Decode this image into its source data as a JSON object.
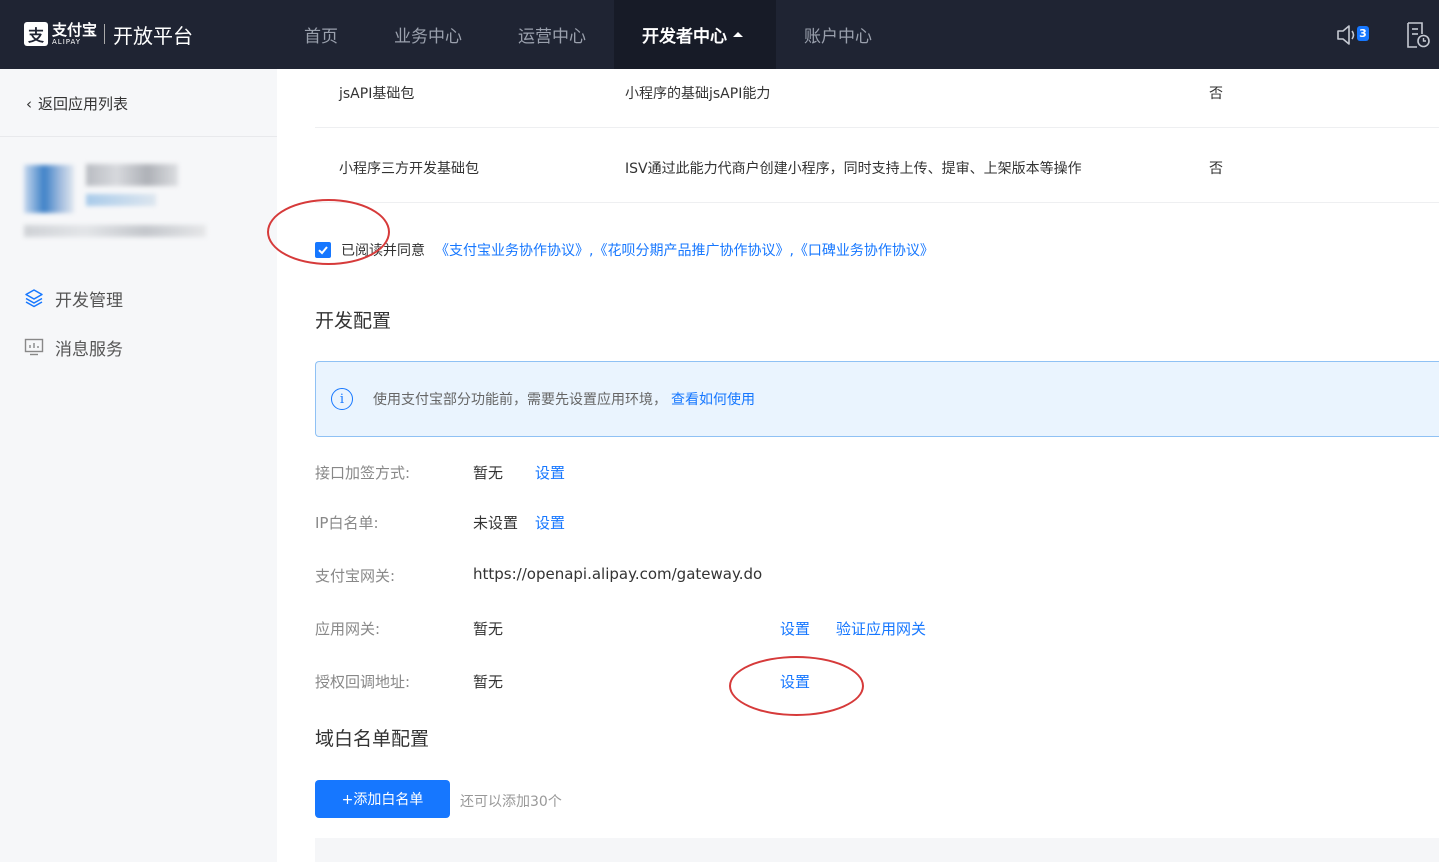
{
  "header": {
    "logo_mark": "支",
    "logo_cn": "支付宝",
    "logo_en": "ALIPAY",
    "platform_title": "开放平台",
    "nav": [
      {
        "label": "首页"
      },
      {
        "label": "业务中心"
      },
      {
        "label": "运营中心"
      },
      {
        "label": "开发者中心"
      },
      {
        "label": "账户中心"
      }
    ],
    "notifications_count": "3"
  },
  "sidebar": {
    "back_label": "返回应用列表",
    "menu": [
      {
        "label": "开发管理",
        "icon": "layers-icon"
      },
      {
        "label": "消息服务",
        "icon": "monitor-chart-icon"
      }
    ]
  },
  "table": {
    "rows": [
      {
        "name": "jsAPI基础包",
        "desc": "小程序的基础jsAPI能力",
        "flag": "否"
      },
      {
        "name": "小程序三方开发基础包",
        "desc": "ISV通过此能力代商户创建小程序，同时支持上传、提审、上架版本等操作",
        "flag": "否"
      }
    ]
  },
  "agreement": {
    "checked": true,
    "text": "已阅读并同意",
    "links": "《支付宝业务协作协议》,《花呗分期产品推广协作协议》,《口碑业务协作协议》"
  },
  "dev_config": {
    "title": "开发配置",
    "info_text": "使用支付宝部分功能前，需要先设置应用环境，",
    "info_link": "查看如何使用",
    "rows": [
      {
        "label": "接口加签方式:",
        "value": "暂无",
        "link": "设置"
      },
      {
        "label": "IP白名单:",
        "value": "未设置",
        "link": "设置"
      },
      {
        "label": "支付宝网关:",
        "value": "https://openapi.alipay.com/gateway.do"
      },
      {
        "label": "应用网关:",
        "value": "暂无",
        "link": "设置",
        "link2": "验证应用网关"
      },
      {
        "label": "授权回调地址:",
        "value": "暂无",
        "link": "设置"
      }
    ]
  },
  "whitelist": {
    "title": "域白名单配置",
    "add_button": "+添加白名单",
    "hint": "还可以添加30个"
  },
  "colors": {
    "topbar": "#1f2433",
    "accent": "#1677ff",
    "annotation": "#d63a3a"
  }
}
